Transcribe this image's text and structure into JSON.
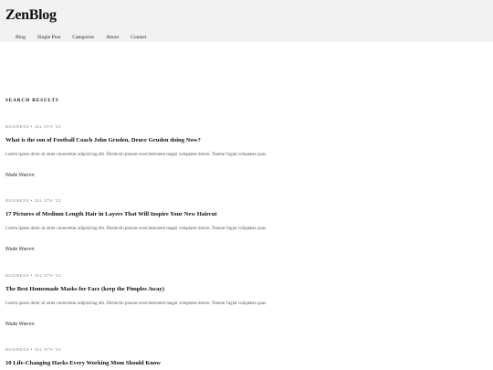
{
  "site": {
    "logo": "ZenBlog"
  },
  "nav": [
    "Blog",
    "Single Post",
    "Categories",
    "About",
    "Contact"
  ],
  "search": {
    "heading": "SEARCH RESULTS"
  },
  "posts": [
    {
      "meta": "BUSINESS • JUL 5TH '22",
      "title": "What is the son of Football Coach John Gruden, Deuce Gruden doing Now?",
      "excerpt": "Lorem ipsum dolor sit amet consectetur adipisicing elit. Distinctio placeat exercitationem magni voluptates dolore. Tenetur fugiat voluptates quas.",
      "author": "Wade Warren"
    },
    {
      "meta": "BUSINESS • JUL 5TH '22",
      "title": "17 Pictures of Medium Length Hair in Layers That Will Inspire Your New Haircut",
      "excerpt": "Lorem ipsum dolor sit amet consectetur adipisicing elit. Distinctio placeat exercitationem magni voluptates dolore. Tenetur fugiat voluptates quas.",
      "author": "Wade Warren"
    },
    {
      "meta": "BUSINESS • JUL 5TH '22",
      "title": "The Best Homemade Masks for Face (keep the Pimples Away)",
      "excerpt": "Lorem ipsum dolor sit amet consectetur adipisicing elit. Distinctio placeat exercitationem magni voluptates dolore. Tenetur fugiat voluptates quas.",
      "author": "Wade Warren"
    },
    {
      "meta": "BUSINESS • JUL 5TH '22",
      "title": "10 Life-Changing Hacks Every Working Mom Should Know"
    }
  ]
}
